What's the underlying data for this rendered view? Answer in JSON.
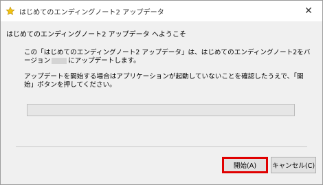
{
  "window": {
    "title": "はじめてのエンディングノート2 アップデータ",
    "close_glyph": "✕",
    "app_icon": "star-icon"
  },
  "content": {
    "welcome": "はじめてのエンディングノート2 アップデータ へようこそ",
    "paragraph1_before": "この「はじめてのエンディングノート2 アップデータ」は、はじめてのエンディングノート2をバージョン",
    "paragraph1_after": "にアップデートします。",
    "paragraph2": "アップデートを開始する場合はアプリケーションが起動していないことを確認したうえで、「開始」ボタンを押してください。"
  },
  "progress": {
    "fraction": 0
  },
  "buttons": {
    "start": "開始(A)",
    "cancel": "キャンセル(C)"
  },
  "colors": {
    "highlight": "#e00000",
    "star": "#f1c40f"
  }
}
